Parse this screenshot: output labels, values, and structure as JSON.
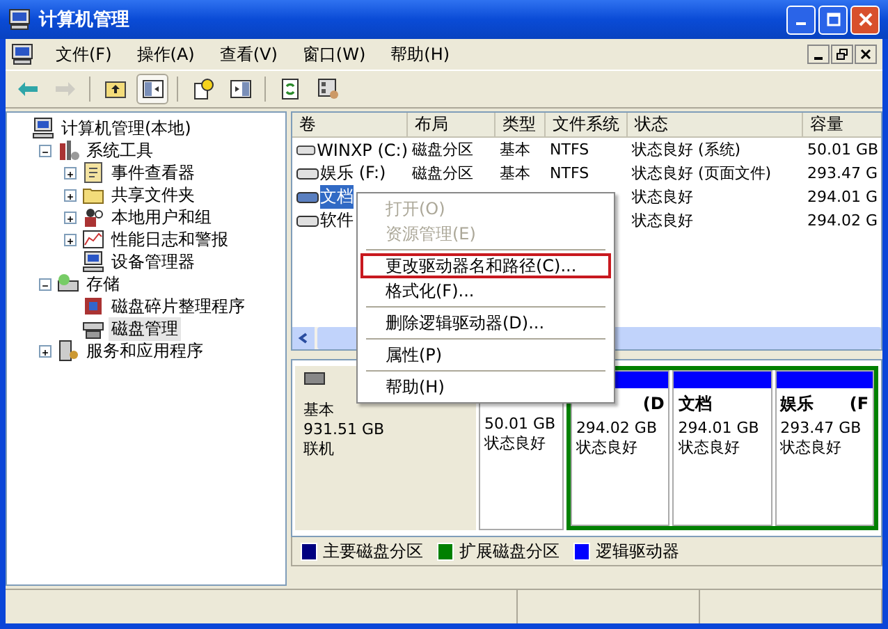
{
  "window": {
    "title": "计算机管理"
  },
  "menu": [
    "文件(F)",
    "操作(A)",
    "查看(V)",
    "窗口(W)",
    "帮助(H)"
  ],
  "toolbar": [
    {
      "kind": "back",
      "disabled": false,
      "pressed": false
    },
    {
      "kind": "forward",
      "disabled": true,
      "pressed": false
    },
    {
      "kind": "sep"
    },
    {
      "kind": "up",
      "disabled": false,
      "pressed": false
    },
    {
      "kind": "tree",
      "disabled": false,
      "pressed": true
    },
    {
      "kind": "sep"
    },
    {
      "kind": "help",
      "disabled": false,
      "pressed": false
    },
    {
      "kind": "pane",
      "disabled": false,
      "pressed": false
    },
    {
      "kind": "sep"
    },
    {
      "kind": "refresh",
      "disabled": false,
      "pressed": false
    },
    {
      "kind": "props",
      "disabled": false,
      "pressed": false
    }
  ],
  "tree": [
    {
      "label": "计算机管理(本地)",
      "selected": false,
      "children": [
        {
          "label": "系统工具",
          "expanded": true,
          "selected": false,
          "children": [
            {
              "label": "事件查看器",
              "expanded": false,
              "selected": false
            },
            {
              "label": "共享文件夹",
              "expanded": false,
              "selected": false
            },
            {
              "label": "本地用户和组",
              "expanded": false,
              "selected": false
            },
            {
              "label": "性能日志和警报",
              "expanded": false,
              "selected": false
            },
            {
              "label": "设备管理器",
              "selected": false
            }
          ]
        },
        {
          "label": "存储",
          "expanded": true,
          "selected": false,
          "children": [
            {
              "label": "磁盘碎片整理程序",
              "selected": false
            },
            {
              "label": "磁盘管理",
              "selected": true
            }
          ]
        },
        {
          "label": "服务和应用程序",
          "expanded": false,
          "selected": false
        }
      ]
    }
  ],
  "table": {
    "columns": [
      "卷",
      "布局",
      "类型",
      "文件系统",
      "状态",
      "容量"
    ],
    "rows": [
      {
        "cells": [
          "WINXP (C:)",
          "磁盘分区",
          "基本",
          "NTFS",
          "状态良好 (系统)",
          "50.01 GB"
        ],
        "selected": false
      },
      {
        "cells": [
          "娱乐 (F:)",
          "磁盘分区",
          "基本",
          "NTFS",
          "状态良好 (页面文件)",
          "293.47 G"
        ],
        "selected": false
      },
      {
        "cells": [
          "文档",
          "",
          "",
          "",
          "状态良好",
          "294.01 G"
        ],
        "selected": true
      },
      {
        "cells": [
          "软件",
          "",
          "",
          "",
          "状态良好",
          "294.02 G"
        ],
        "selected": false
      }
    ]
  },
  "context_menu": [
    {
      "kind": "item",
      "label": "打开(O)",
      "disabled": true,
      "highlighted": false
    },
    {
      "kind": "item",
      "label": "资源管理(E)",
      "disabled": true,
      "highlighted": false
    },
    {
      "kind": "sep"
    },
    {
      "kind": "item",
      "label": "更改驱动器名和路径(C)...",
      "disabled": false,
      "highlighted": true
    },
    {
      "kind": "item",
      "label": "格式化(F)...",
      "disabled": false,
      "highlighted": false
    },
    {
      "kind": "sep"
    },
    {
      "kind": "item",
      "label": "删除逻辑驱动器(D)...",
      "disabled": false,
      "highlighted": false
    },
    {
      "kind": "sep"
    },
    {
      "kind": "item",
      "label": "属性(P)",
      "disabled": false,
      "highlighted": false
    },
    {
      "kind": "sep"
    },
    {
      "kind": "item",
      "label": "帮助(H)",
      "disabled": false,
      "highlighted": false
    }
  ],
  "disk": {
    "type": "基本",
    "size": "931.51 GB",
    "status": "联机",
    "partitions": [
      {
        "size": "50.01 GB",
        "status": "状态良好"
      }
    ],
    "extended": [
      {
        "kind": "logical",
        "drive": "(D",
        "size": "294.02 GB",
        "status": "状态良好"
      },
      {
        "kind": "logical",
        "label": "文档",
        "size": "294.01 GB",
        "status": "状态良好"
      },
      {
        "kind": "logical",
        "label": "娱乐",
        "drive": "(F",
        "size": "293.47 GB",
        "status": "状态良好"
      }
    ]
  },
  "legend": [
    {
      "label": "主要磁盘分区",
      "color": "#000080"
    },
    {
      "label": "扩展磁盘分区",
      "color": "#008000"
    },
    {
      "label": "逻辑驱动器",
      "color": "#0000ff"
    }
  ]
}
